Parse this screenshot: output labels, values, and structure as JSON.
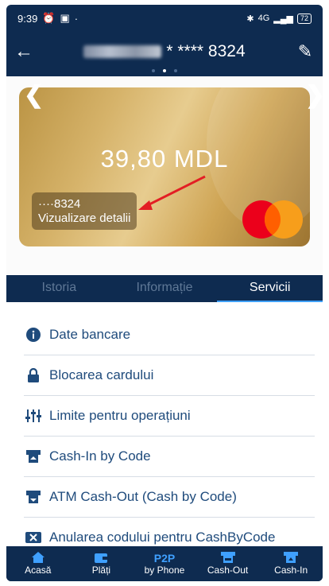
{
  "status": {
    "time": "9:39",
    "network": "4G",
    "battery": "72"
  },
  "header": {
    "title": "* **** 8324"
  },
  "card": {
    "balance": "39,80 MDL",
    "masked": "····8324",
    "details": "Vizualizare detalii"
  },
  "tabs": [
    {
      "label": "Istoria",
      "active": false
    },
    {
      "label": "Informație",
      "active": false
    },
    {
      "label": "Servicii",
      "active": true
    }
  ],
  "services": [
    {
      "label": "Date bancare",
      "icon": "info-icon"
    },
    {
      "label": "Blocarea cardului",
      "icon": "lock-icon"
    },
    {
      "label": "Limite pentru operațiuni",
      "icon": "sliders-icon"
    },
    {
      "label": "Cash-In by Code",
      "icon": "cash-in-icon"
    },
    {
      "label": "ATM Cash-Out (Cash by Code)",
      "icon": "atm-icon"
    },
    {
      "label": "Anularea codului pentru CashByCode",
      "icon": "cancel-code-icon"
    }
  ],
  "bottom_nav": [
    {
      "label": "Acasă",
      "icon": "home-icon"
    },
    {
      "label": "Plăți",
      "icon": "wallet-icon"
    },
    {
      "label": "by Phone",
      "icon_text": "P2P"
    },
    {
      "label": "Cash-Out",
      "icon": "cash-out-icon"
    },
    {
      "label": "Cash-In",
      "icon": "cash-in-icon"
    }
  ],
  "colors": {
    "navy": "#0e2b50",
    "accent": "#3fa0ff",
    "text_blue": "#1f4b7c"
  }
}
